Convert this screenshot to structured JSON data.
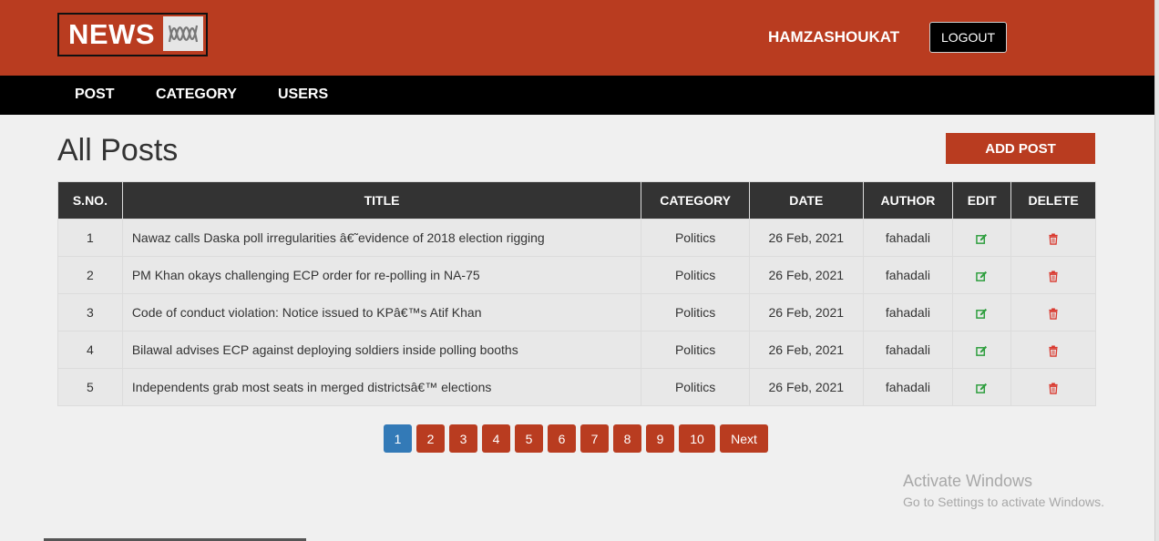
{
  "header": {
    "logo_text": "NEWS",
    "logo_mark_icon": "abc-news-logo-icon",
    "username": "HAMZASHOUKAT",
    "logout_label": "LOGOUT",
    "brand_color": "#b93c20"
  },
  "nav": {
    "items": [
      {
        "label": "POST"
      },
      {
        "label": "CATEGORY"
      },
      {
        "label": "USERS"
      }
    ]
  },
  "main": {
    "title": "All Posts",
    "add_post_label": "ADD POST"
  },
  "table": {
    "headers": [
      "S.NO.",
      "TITLE",
      "CATEGORY",
      "DATE",
      "AUTHOR",
      "EDIT",
      "DELETE"
    ],
    "rows": [
      {
        "sno": "1",
        "title": "Nawaz calls Daska poll irregularities â€˜evidence of 2018 election rigging",
        "category": "Politics",
        "date": "26 Feb, 2021",
        "author": "fahadali"
      },
      {
        "sno": "2",
        "title": "PM Khan okays challenging ECP order for re-polling in NA-75",
        "category": "Politics",
        "date": "26 Feb, 2021",
        "author": "fahadali"
      },
      {
        "sno": "3",
        "title": "Code of conduct violation: Notice issued to KPâ€™s Atif Khan",
        "category": "Politics",
        "date": "26 Feb, 2021",
        "author": "fahadali"
      },
      {
        "sno": "4",
        "title": "Bilawal advises ECP against deploying soldiers inside polling booths",
        "category": "Politics",
        "date": "26 Feb, 2021",
        "author": "fahadali"
      },
      {
        "sno": "5",
        "title": "Independents grab most seats in merged districtsâ€™ elections",
        "category": "Politics",
        "date": "26 Feb, 2021",
        "author": "fahadali"
      }
    ],
    "edit_icon": "edit-icon",
    "delete_icon": "trash-icon",
    "edit_color": "#2e9e3e",
    "delete_color": "#d9382e"
  },
  "pagination": {
    "pages": [
      "1",
      "2",
      "3",
      "4",
      "5",
      "6",
      "7",
      "8",
      "9",
      "10"
    ],
    "active": "1",
    "next_label": "Next",
    "active_color": "#337ab7"
  },
  "watermark": {
    "title": "Activate Windows",
    "subtitle": "Go to Settings to activate Windows."
  }
}
